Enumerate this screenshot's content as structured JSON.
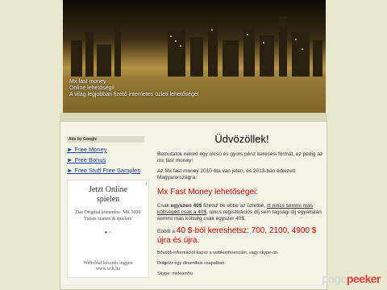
{
  "header": {
    "lines": [
      "Mx fast money",
      "Online lehetőségi!",
      "A világ legjobban fizető internetes üzleti lehetősége!"
    ]
  },
  "sidebar": {
    "ads_by": "Ads by Google",
    "links": [
      "► Free Money",
      "► Free Bonus",
      "► Free Stuff Free Samples"
    ]
  },
  "ad": {
    "info": "i",
    "title_line1": "Jetzt Online",
    "title_line2": "spielen",
    "sub": "Das Original kostenlos- Mit 5000 Twists starten & spielen!",
    "dots": "● ○",
    "foot1": "Weboldal készítés ingyen",
    "foot2": "www.wik.hu"
  },
  "main": {
    "title": "Üdvözöllek!",
    "p1": "Bemutatok neked egy olcsó és gyors pénz keresési formát, ez pedig az mx fast money!",
    "p2": "Az Mx fast money 2010 óta van jelen, és 2013-ban érkezett Magyarországra.",
    "h2": "Mx Fast Money lehetőségei:",
    "p3_a": "Csak ",
    "p3_b": "egyszeri 40$",
    "p3_c": " fizetsz be ebbe az üzletbe, ",
    "p3_d": "itt nincs semmi más költséged csak a 40$",
    "p3_e": ", nincs regisztrációs díj sem tagsági díj egyáltalán semmi más költség csak egyszer 40$.",
    "p4_a": "Ebből a ",
    "p4_b": "40 $-ból kereshetsz: 700, 2100, 4900 $ újra és újra.",
    "s1": "Bővebb információt kapsz a webkonferencián, vagy skype-on.",
    "s2": "Dolgozz egy dinamikus csapatban.",
    "s3": "Skype: mxteamhu"
  },
  "watermark": {
    "page": "page",
    "peeker": "peeker"
  },
  "colors": {
    "link": "#1a3c9a",
    "accent_red": "#d00000",
    "background": "#e8e8cf"
  }
}
